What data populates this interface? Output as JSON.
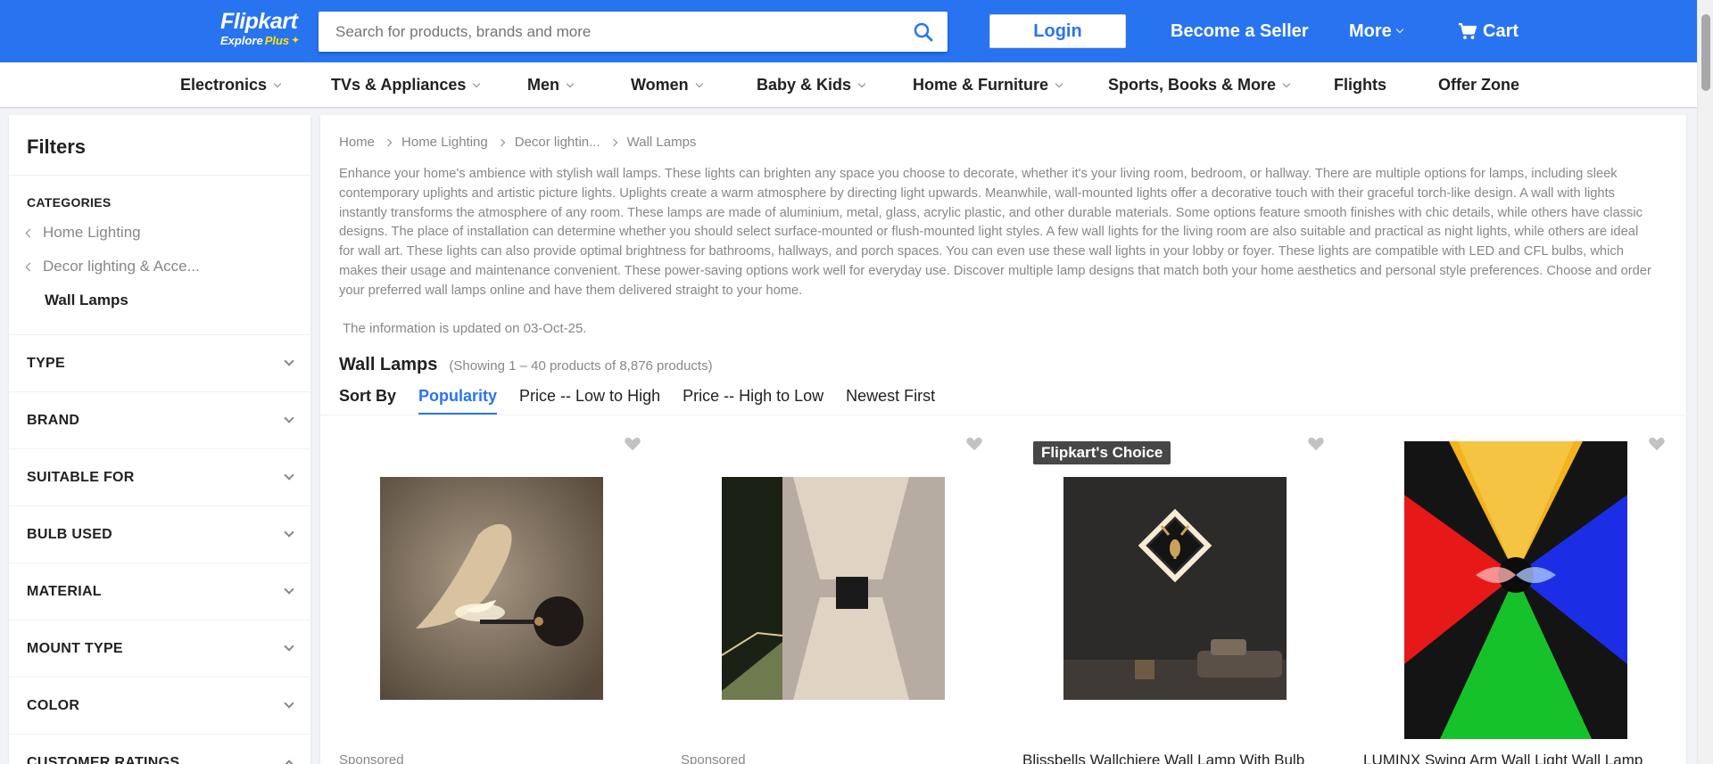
{
  "header": {
    "logo_main": "Flipkart",
    "logo_explore": "Explore",
    "logo_plus": "Plus",
    "search_placeholder": "Search for products, brands and more",
    "login_label": "Login",
    "become_seller": "Become a Seller",
    "more": "More",
    "cart": "Cart",
    "brand_color": "#2874f0"
  },
  "category_nav": [
    {
      "label": "Electronics",
      "has_dropdown": true
    },
    {
      "label": "TVs & Appliances",
      "has_dropdown": true
    },
    {
      "label": "Men",
      "has_dropdown": true
    },
    {
      "label": "Women",
      "has_dropdown": true
    },
    {
      "label": "Baby & Kids",
      "has_dropdown": true
    },
    {
      "label": "Home & Furniture",
      "has_dropdown": true
    },
    {
      "label": "Sports, Books & More",
      "has_dropdown": true
    },
    {
      "label": "Flights",
      "has_dropdown": false
    },
    {
      "label": "Offer Zone",
      "has_dropdown": false
    }
  ],
  "sidebar": {
    "title": "Filters",
    "categories_label": "CATEGORIES",
    "category_path": [
      "Home Lighting",
      "Decor lighting & Acce..."
    ],
    "current_category": "Wall Lamps",
    "facets": [
      "TYPE",
      "BRAND",
      "SUITABLE FOR",
      "BULB USED",
      "MATERIAL",
      "MOUNT TYPE",
      "COLOR",
      "CUSTOMER RATINGS"
    ]
  },
  "main": {
    "breadcrumb": [
      "Home",
      "Home Lighting",
      "Decor lightin...",
      "Wall Lamps"
    ],
    "description": "Enhance your home's ambience with stylish wall lamps. These lights can brighten any space you choose to decorate, whether it's your living room, bedroom, or hallway. There are multiple options for lamps, including sleek contemporary uplights and artistic picture lights. Uplights create a warm atmosphere by directing light upwards. Meanwhile, wall-mounted lights offer a decorative touch with their graceful torch-like design. A wall with lights instantly transforms the atmosphere of any room. These lamps are made of aluminium, metal, glass, acrylic plastic, and other durable materials. Some options feature smooth finishes with chic details, while others have classic designs. The place of installation can determine whether you should select surface-mounted or flush-mounted light styles. A few wall lights for the living room are also suitable and practical as night lights, while others are ideal for wall art. These lights can also provide optimal brightness for bathrooms, hallways, and porch spaces. You can even use these wall lights in your lobby or foyer. These lights are compatible with LED and CFL bulbs, which makes their usage and maintenance convenient. These power-saving options work well for everyday use. Discover multiple lamp designs that match both your home aesthetics and personal style preferences. Choose and order your preferred wall lamps online and have them delivered straight to your home.",
    "updated": "The information is updated on 03-Oct-25.",
    "results_title": "Wall Lamps",
    "results_count": "(Showing 1 – 40 products of 8,876 products)",
    "sort_label": "Sort By",
    "sort_options": [
      "Popularity",
      "Price -- Low to High",
      "Price -- High to Low",
      "Newest First"
    ],
    "sort_active": "Popularity"
  },
  "products": [
    {
      "image": "bird-wall-lamp",
      "badge": "",
      "footer": "Sponsored"
    },
    {
      "image": "up-down-cube-wall-lamp",
      "badge": "",
      "footer": "Sponsored"
    },
    {
      "image": "deer-frame-wall-lamp",
      "badge": "Flipkart's Choice",
      "footer": "Blissbells Wallchiere Wall Lamp With Bulb"
    },
    {
      "image": "rgb-swing-arm-wall-lamp",
      "badge": "",
      "footer": "LUMINX Swing Arm Wall Light Wall Lamp"
    }
  ]
}
